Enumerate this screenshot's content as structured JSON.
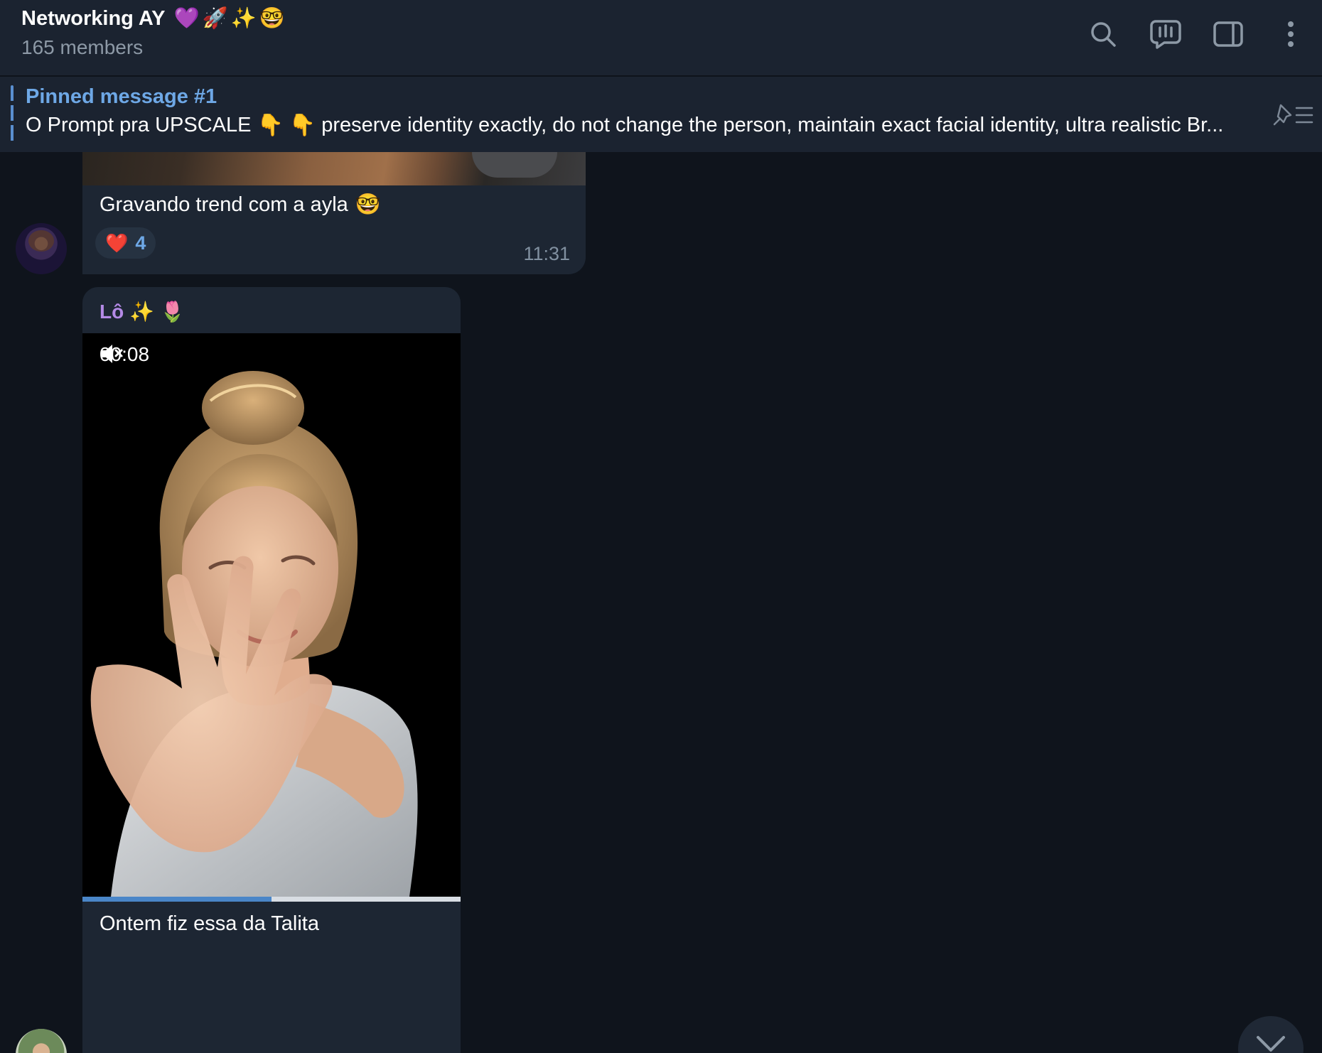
{
  "header": {
    "title": "Networking AY",
    "title_emojis": [
      "💜",
      "🚀",
      "✨",
      "🤓"
    ],
    "members": "165 members",
    "actions": [
      "search-icon",
      "live-chat-icon",
      "side-panel-icon",
      "more-vertical-icon"
    ]
  },
  "pinned": {
    "title": "Pinned message #1",
    "text_prefix": "O Prompt pra UPSCALE",
    "hand_emojis": [
      "👇",
      "👇"
    ],
    "text_body": "preserve identity exactly, do not change the person, maintain exact facial identity, ultra realistic Br..."
  },
  "messages": [
    {
      "text": "Gravando trend com a ayla",
      "text_emoji": "🤓",
      "reaction": {
        "emoji": "❤️",
        "count": "4"
      },
      "time": "11:31"
    },
    {
      "sender": "Lô",
      "sender_emojis": [
        "✨",
        "🌷"
      ],
      "video": {
        "duration": "00:08",
        "muted": true,
        "progress": 0.5
      },
      "text": "Ontem fiz essa da Talita"
    }
  ],
  "colors": {
    "background": "#0f141c",
    "header": "#1b2330",
    "bubble": "#1d2633",
    "accent": "#6ea8e6",
    "sender_name": "#b48ae6"
  }
}
